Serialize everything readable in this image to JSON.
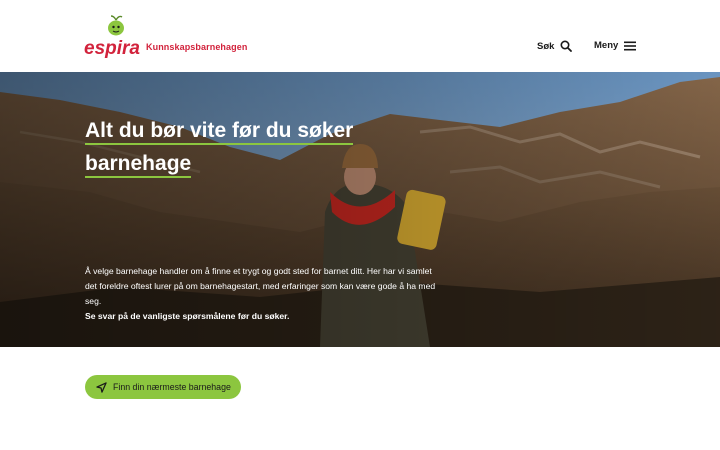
{
  "header": {
    "logo_text": "espira",
    "brand_subtitle": "Kunnskapsbarnehagen",
    "search_label": "Søk",
    "menu_label": "Meny"
  },
  "hero": {
    "title_line1": "Alt du bør vite før du søker",
    "title_line2": "barnehage",
    "body_text": "Å velge barnehage handler om å finne et trygt og godt sted for barnet ditt. Her har vi samlet det foreldre oftest lurer på om barnehagestart, med erfaringer som kan være gode å ha med seg.",
    "body_strong": "Se svar på de vanligste spørsmålene før du søker."
  },
  "cta": {
    "label": "Finn din nærmeste barnehage"
  },
  "colors": {
    "brand_red": "#d2233c",
    "accent_green": "#8cc63f",
    "sky": "#7fa9cf"
  }
}
